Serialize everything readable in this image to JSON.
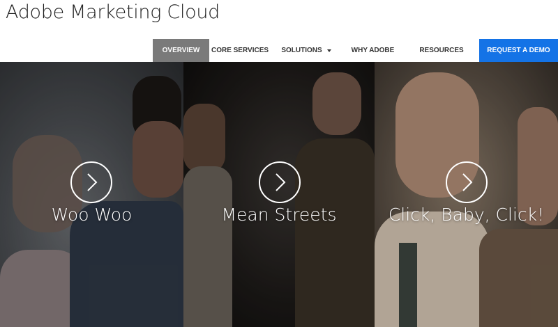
{
  "brand": {
    "title": "Adobe Marketing Cloud"
  },
  "nav": {
    "items": [
      {
        "label": "OVERVIEW"
      },
      {
        "label": "CORE SERVICES"
      },
      {
        "label": "SOLUTIONS"
      },
      {
        "label": "WHY ADOBE"
      },
      {
        "label": "RESOURCES"
      }
    ],
    "cta_label": "REQUEST A DEMO",
    "active_item": "OVERVIEW",
    "dropdown_item": "SOLUTIONS",
    "colors": {
      "active_bg": "#7a7a7a",
      "cta_bg": "#1473e6"
    }
  },
  "hero": {
    "panels": [
      {
        "title": "Woo Woo",
        "icon": "play-circle-icon"
      },
      {
        "title": "Mean Streets",
        "icon": "play-circle-icon"
      },
      {
        "title": "Click, Baby, Click!",
        "icon": "play-circle-icon"
      }
    ]
  }
}
